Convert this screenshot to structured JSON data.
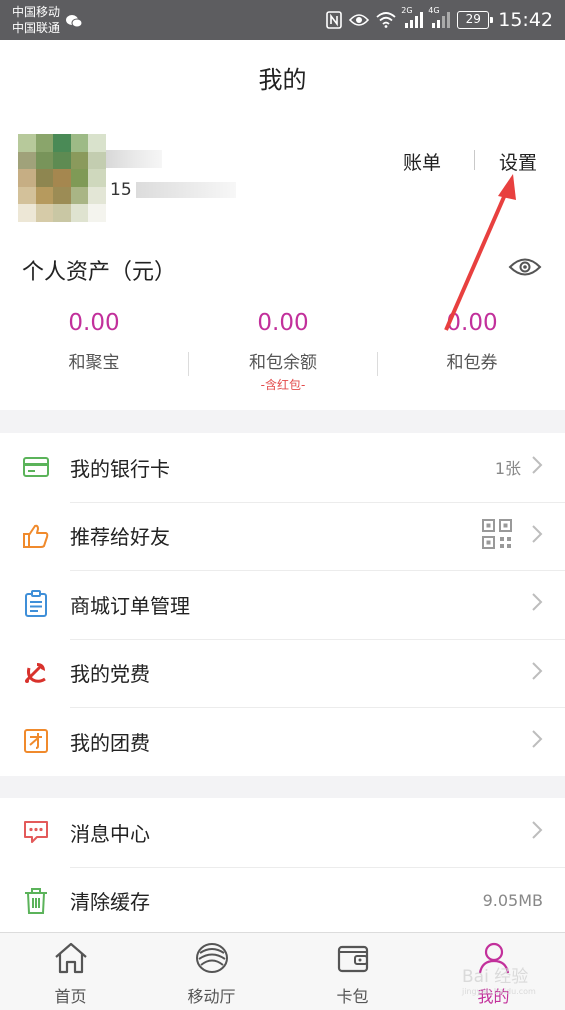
{
  "status_bar": {
    "carrier_1": "中国移动",
    "carrier_2": "中国联通",
    "network_1": "2G",
    "network_2": "4G",
    "battery": "29",
    "time": "15:42"
  },
  "header": {
    "title": "我的"
  },
  "profile": {
    "phone_prefix": "15",
    "bill_label": "账单",
    "settings_label": "设置"
  },
  "assets": {
    "title": "个人资产（元）",
    "items": [
      {
        "value": "0.00",
        "label": "和聚宝",
        "sub": ""
      },
      {
        "value": "0.00",
        "label": "和包余额",
        "sub": "-含红包-"
      },
      {
        "value": "0.00",
        "label": "和包券",
        "sub": ""
      }
    ]
  },
  "menu_group_1": [
    {
      "label": "我的银行卡",
      "value": "1张",
      "icon": "bank-card-icon"
    },
    {
      "label": "推荐给好友",
      "value": "",
      "icon": "thumbs-up-icon"
    },
    {
      "label": "商城订单管理",
      "value": "",
      "icon": "order-list-icon"
    },
    {
      "label": "我的党费",
      "value": "",
      "icon": "party-emblem-icon"
    },
    {
      "label": "我的团费",
      "value": "",
      "icon": "league-fee-icon"
    }
  ],
  "menu_group_2": [
    {
      "label": "消息中心",
      "value": "",
      "icon": "message-icon"
    },
    {
      "label": "清除缓存",
      "value": "9.05MB",
      "icon": "trash-icon"
    }
  ],
  "tabbar": [
    {
      "label": "首页",
      "icon": "home-icon",
      "active": false
    },
    {
      "label": "移动厅",
      "icon": "china-mobile-icon",
      "active": false
    },
    {
      "label": "卡包",
      "icon": "wallet-icon",
      "active": false
    },
    {
      "label": "我的",
      "icon": "profile-icon",
      "active": true
    }
  ],
  "colors": {
    "accent": "#c2309b",
    "red_note": "#e34a4a",
    "status_bar": "#5d5d60",
    "annotation_arrow": "#e8403f"
  },
  "watermark": {
    "text": "Bai 经验",
    "sub": "jingyan.baidu.com"
  }
}
